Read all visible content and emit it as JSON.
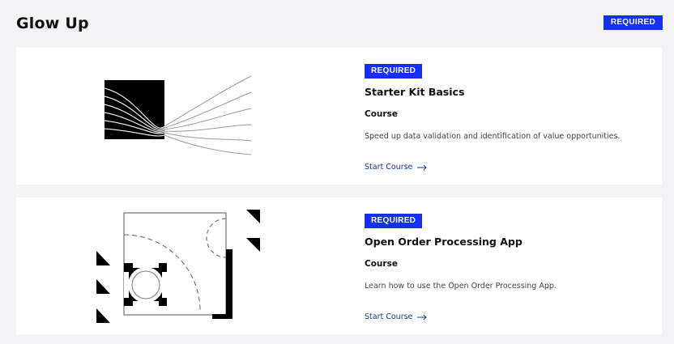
{
  "header": {
    "title": "Glow Up",
    "badge": "REQUIRED"
  },
  "courses": [
    {
      "badge": "REQUIRED",
      "title": "Starter Kit Basics",
      "type": "Course",
      "description": "Speed up data validation and identification of value opportunities.",
      "cta": "Start Course",
      "illustration_icon": "square-curves-illustration"
    },
    {
      "badge": "REQUIRED",
      "title": "Open Order Processing App",
      "type": "Course",
      "description": "Learn how to use the Open Order Processing App.",
      "cta": "Start Course",
      "illustration_icon": "geometric-circle-illustration"
    }
  ],
  "colors": {
    "accent": "#1530f0",
    "link": "#1b2f9e",
    "background": "#f3f3f6",
    "card": "#ffffff"
  }
}
